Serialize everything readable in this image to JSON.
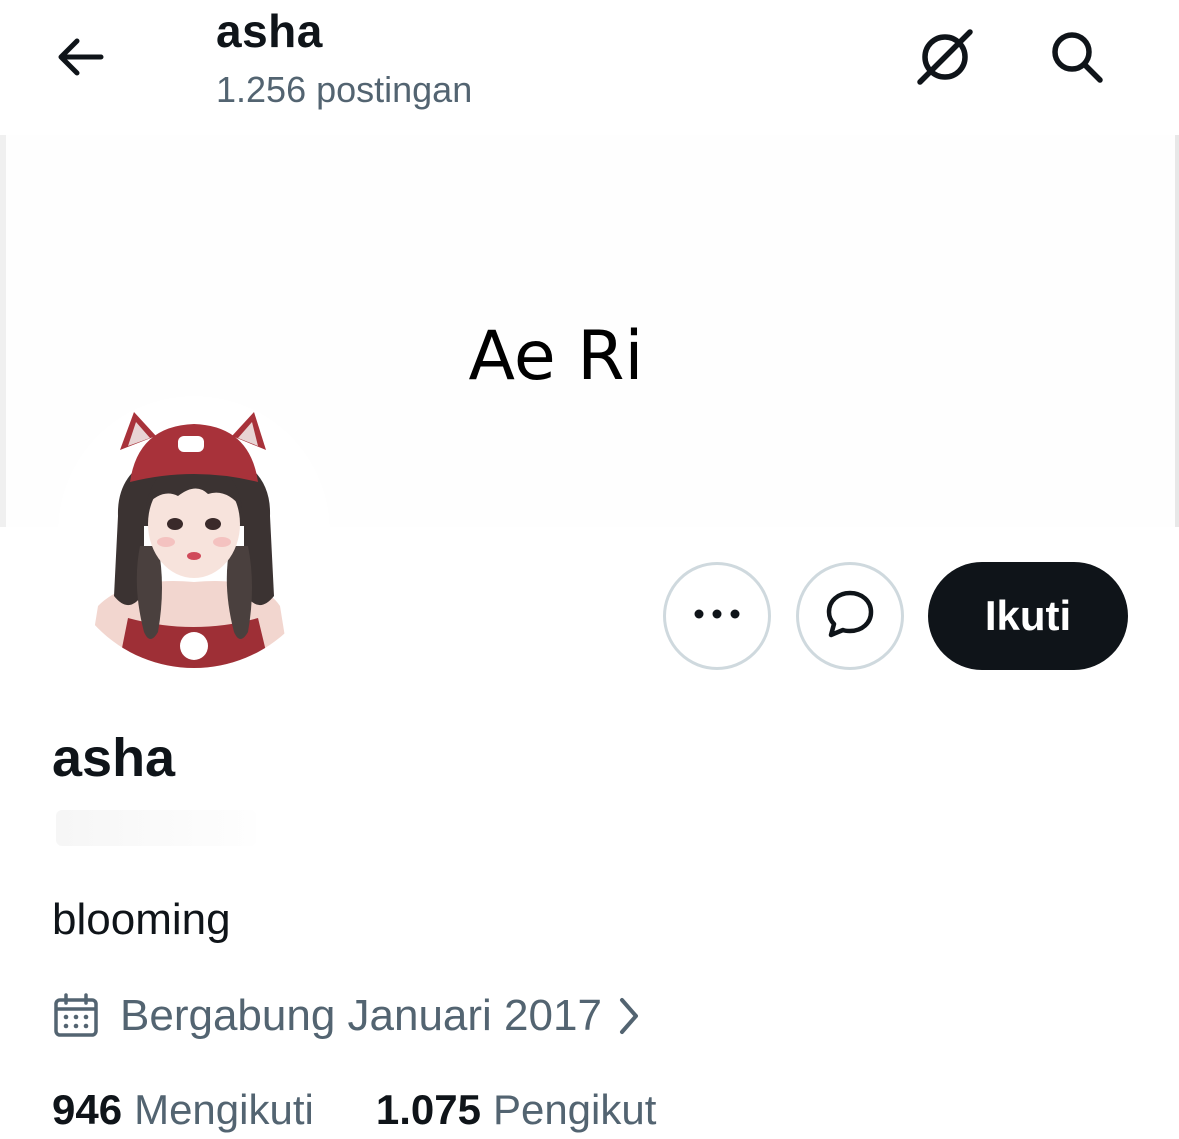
{
  "header": {
    "title": "asha",
    "post_count": "1.256 postingan"
  },
  "icons": {
    "back": "arrow-left-icon",
    "grok": "grok-icon",
    "search": "search-icon",
    "more": "more-dots-icon",
    "message": "message-bubble-icon",
    "calendar": "calendar-icon",
    "chevron": "chevron-right-icon"
  },
  "banner": {
    "text": "Ae Ri"
  },
  "actions": {
    "follow_label": "Ikuti"
  },
  "profile": {
    "display_name": "asha",
    "bio": "blooming",
    "joined": "Bergabung Januari 2017"
  },
  "stats": {
    "following_count": "946",
    "following_label": "Mengikuti",
    "followers_count": "1.075",
    "followers_label": "Pengikut"
  },
  "colors": {
    "text_primary": "#0f1419",
    "text_secondary": "#536471",
    "button_dark": "#0f1419",
    "border": "#cfd9de",
    "avatar_hat": "#a8323a"
  }
}
